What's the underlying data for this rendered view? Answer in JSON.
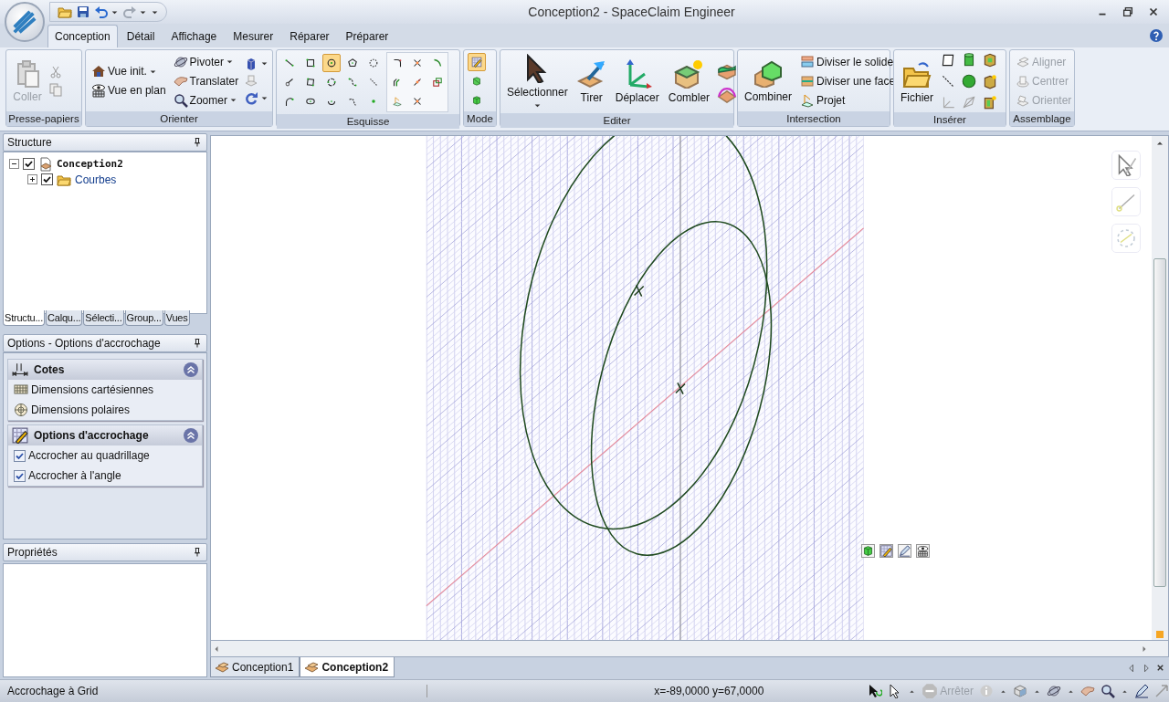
{
  "window": {
    "title": "Conception2 - SpaceClaim Engineer"
  },
  "quick_access": {
    "undo_enabled": true,
    "redo_enabled": false
  },
  "ribbon_tabs": [
    {
      "label": "Conception",
      "selected": true
    },
    {
      "label": "Détail",
      "selected": false
    },
    {
      "label": "Affichage",
      "selected": false
    },
    {
      "label": "Mesurer",
      "selected": false
    },
    {
      "label": "Réparer",
      "selected": false
    },
    {
      "label": "Préparer",
      "selected": false
    }
  ],
  "ribbon_groups": [
    {
      "kind": "clipboard",
      "label": "Presse-papiers",
      "buttons": [
        {
          "label": "Coller",
          "disabled": true
        }
      ]
    },
    {
      "kind": "orient",
      "label": "Orienter",
      "buttons": [
        {
          "label": "Vue init.",
          "dropdown": true
        },
        {
          "label": "Vue en plan",
          "dropdown": false
        },
        {
          "label": "Pivoter",
          "dropdown": true
        },
        {
          "label": "Translater",
          "dropdown": false
        },
        {
          "label": "Zoomer",
          "dropdown": true
        }
      ]
    },
    {
      "kind": "sketch",
      "label": "Esquisse",
      "tools": [
        {
          "selected": false
        },
        {
          "selected": false
        },
        {
          "selected": true
        },
        {
          "selected": false
        },
        {
          "selected": false
        },
        {
          "selected": false
        },
        {
          "selected": false
        },
        {
          "selected": false
        },
        {
          "selected": false
        },
        {
          "selected": false
        },
        {
          "selected": false
        },
        {
          "selected": false
        },
        {
          "selected": false
        },
        {
          "selected": false
        },
        {
          "selected": false
        },
        {
          "selected": false
        },
        {
          "selected": false
        },
        {
          "selected": false
        },
        {
          "selected": false
        },
        {
          "selected": false
        },
        {
          "selected": false
        },
        {
          "selected": false
        },
        {
          "selected": false
        }
      ]
    },
    {
      "kind": "mode",
      "label": "Mode",
      "tools": [
        {
          "selected": true
        },
        {
          "selected": false
        },
        {
          "selected": false
        }
      ]
    },
    {
      "kind": "edit",
      "label": "Editer",
      "buttons": [
        {
          "label": "Sélectionner",
          "dropdown": true
        },
        {
          "label": "Tirer",
          "dropdown": false
        },
        {
          "label": "Déplacer",
          "dropdown": false
        },
        {
          "label": "Combler",
          "dropdown": false
        }
      ]
    },
    {
      "kind": "intersect",
      "label": "Intersection",
      "buttons": [
        {
          "label": "Combiner"
        },
        {
          "label": "Diviser le solide"
        },
        {
          "label": "Diviser une face"
        },
        {
          "label": "Projet"
        }
      ]
    },
    {
      "kind": "insert",
      "label": "Insérer",
      "buttons": [
        {
          "label": "Fichier"
        }
      ]
    },
    {
      "kind": "assembly",
      "label": "Assemblage",
      "buttons": [
        {
          "label": "Aligner",
          "disabled": true
        },
        {
          "label": "Centrer",
          "disabled": true
        },
        {
          "label": "Orienter",
          "disabled": true
        }
      ]
    }
  ],
  "structure_panel": {
    "title": "Structure",
    "tree": [
      {
        "label": "Conception2",
        "checked": true,
        "expanded": true,
        "children": [
          {
            "label": "Courbes",
            "checked": true,
            "expanded": false
          }
        ]
      }
    ],
    "tabs": [
      {
        "label": "Structu...",
        "selected": true
      },
      {
        "label": "Calqu...",
        "selected": false
      },
      {
        "label": "Sélecti...",
        "selected": false
      },
      {
        "label": "Group...",
        "selected": false
      },
      {
        "label": "Vues",
        "selected": false
      }
    ]
  },
  "options_panel": {
    "title": "Options - Options d'accrochage",
    "sections": [
      {
        "title": "Cotes",
        "expanded": true,
        "items": [
          {
            "kind": "link",
            "label": "Dimensions cartésiennes"
          },
          {
            "kind": "link",
            "label": "Dimensions polaires"
          }
        ]
      },
      {
        "title": "Options d'accrochage",
        "expanded": true,
        "items": [
          {
            "kind": "checkbox",
            "label": "Accrocher au quadrillage",
            "checked": true
          },
          {
            "kind": "checkbox",
            "label": "Accrocher à l'angle",
            "checked": true
          }
        ]
      }
    ]
  },
  "properties_panel": {
    "title": "Propriétés"
  },
  "document_tabs": [
    {
      "label": "Conception1",
      "selected": false
    },
    {
      "label": "Conception2",
      "selected": true
    }
  ],
  "status_bar": {
    "message": "Accrochage à Grid",
    "coordinates": "x=-89,0000 y=67,0000",
    "stop_button": {
      "label": "Arrêter",
      "disabled": true
    }
  }
}
